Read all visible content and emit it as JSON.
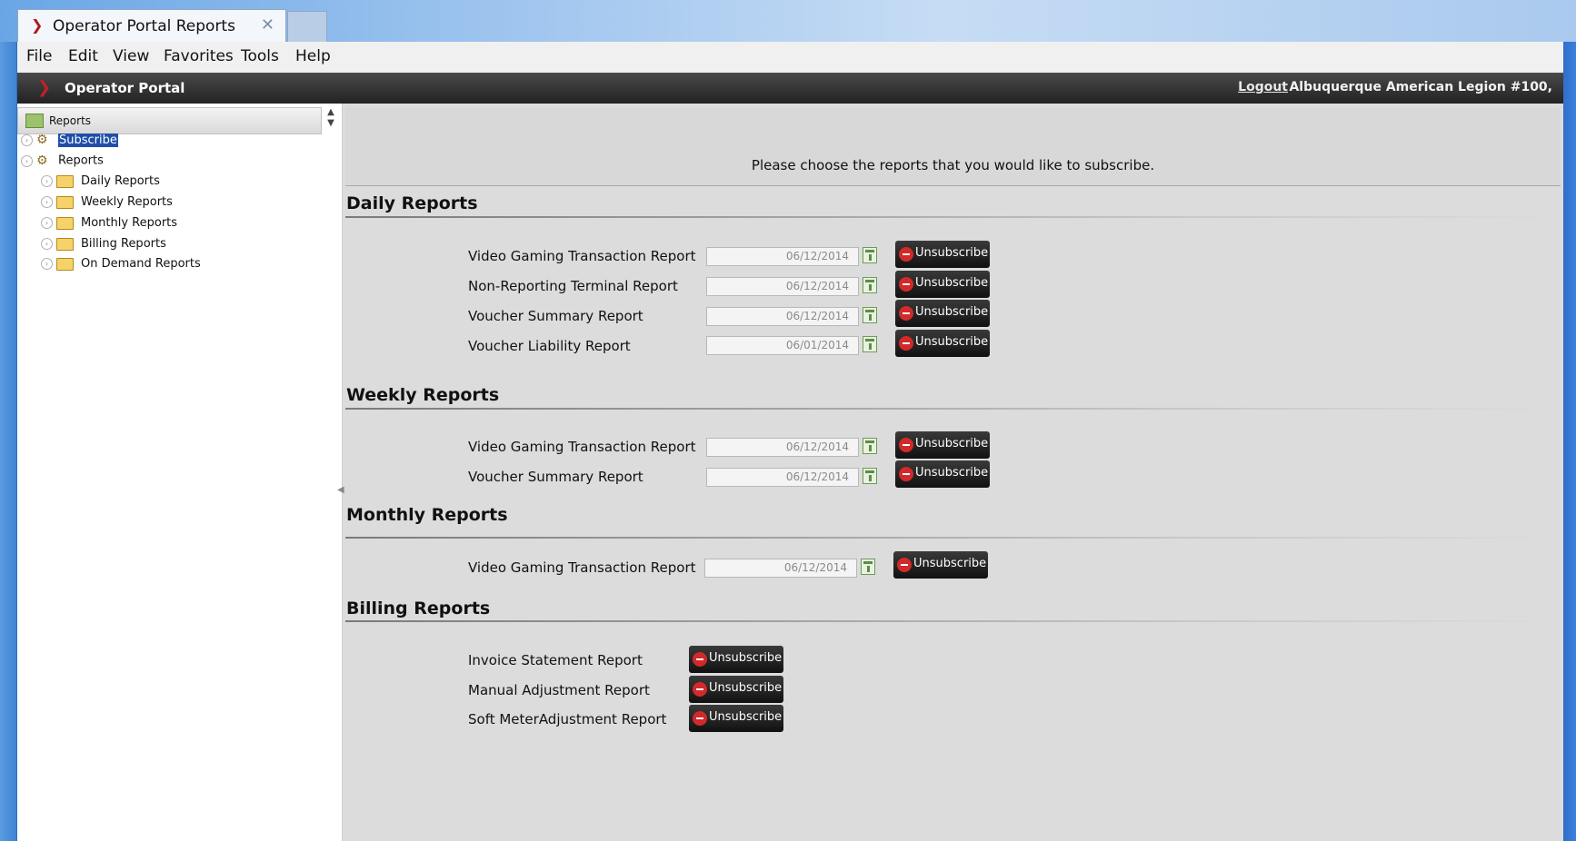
{
  "browser": {
    "tab_title": "Operator Portal Reports",
    "tab_close": "✕",
    "menu": [
      "File",
      "Edit",
      "View",
      "Favorites",
      "Tools",
      "Help"
    ]
  },
  "portal": {
    "title": "Operator Portal",
    "logout": "Logout",
    "organization": "Albuquerque American Legion #100,"
  },
  "sidebar": {
    "header": "Reports",
    "tree": {
      "subscribe": "Subscribe",
      "reports": "Reports",
      "folders": [
        "Daily Reports",
        "Weekly Reports",
        "Monthly Reports",
        "Billing Reports",
        "On Demand Reports"
      ]
    }
  },
  "main": {
    "intro": "Please choose the reports that you would like to subscribe.",
    "unsubscribe_label": "Unsubscribe",
    "sections": {
      "daily": {
        "title": "Daily Reports",
        "reports": [
          {
            "name": "Video Gaming Transaction Report",
            "date": "06/12/2014"
          },
          {
            "name": "Non-Reporting Terminal Report",
            "date": "06/12/2014"
          },
          {
            "name": "Voucher Summary Report",
            "date": "06/12/2014"
          },
          {
            "name": "Voucher Liability Report",
            "date": "06/01/2014"
          }
        ]
      },
      "weekly": {
        "title": "Weekly Reports",
        "reports": [
          {
            "name": "Video Gaming Transaction Report",
            "date": "06/12/2014"
          },
          {
            "name": "Voucher Summary Report",
            "date": "06/12/2014"
          }
        ]
      },
      "monthly": {
        "title": "Monthly Reports",
        "reports": [
          {
            "name": "Video Gaming Transaction Report",
            "date": "06/12/2014"
          }
        ]
      },
      "billing": {
        "title": "Billing Reports",
        "reports": [
          {
            "name": "Invoice Statement Report"
          },
          {
            "name": "Manual Adjustment Report"
          },
          {
            "name": "Soft MeterAdjustment Report"
          }
        ]
      }
    }
  }
}
